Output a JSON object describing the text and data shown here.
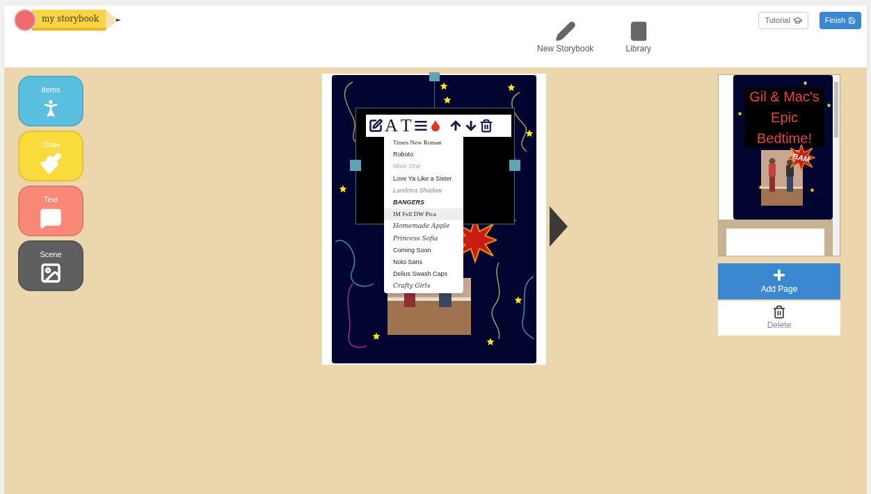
{
  "app": {
    "logo": "my storybook"
  },
  "nav": [
    {
      "kind": "pencil",
      "label": "New Storybook"
    },
    {
      "kind": "book",
      "label": "Library"
    }
  ],
  "actions": [
    {
      "kind": "tutorial",
      "label": "Tutorial"
    },
    {
      "kind": "finish",
      "label": "Finish"
    }
  ],
  "tools": [
    {
      "kind": "items",
      "label": "Items",
      "color": "#5bbfe0"
    },
    {
      "kind": "draw",
      "label": "Draw",
      "color": "#f9dc3c"
    },
    {
      "kind": "text",
      "label": "Text",
      "color": "#fa8877"
    },
    {
      "kind": "scene",
      "label": "Scene",
      "color": "#5f5f5f"
    }
  ],
  "editor": {
    "toolbar": [
      {
        "kind": "edit"
      },
      {
        "kind": "font",
        "glyph": "A"
      },
      {
        "kind": "size",
        "glyph": "T"
      },
      {
        "kind": "align"
      },
      {
        "kind": "color"
      },
      {
        "kind": "up"
      },
      {
        "kind": "down"
      },
      {
        "kind": "delete"
      }
    ],
    "font_menu": [
      {
        "label": "Times New Roman",
        "kind": "serif",
        "selected": false
      },
      {
        "label": "Roboto",
        "kind": "sans",
        "selected": false
      },
      {
        "label": "Nixie One",
        "kind": "faint",
        "selected": false
      },
      {
        "label": "Love Ya Like a Sister",
        "kind": "sans",
        "selected": false
      },
      {
        "label": "Landrina Shadow",
        "kind": "ghost",
        "selected": false
      },
      {
        "label": "BANGERS",
        "kind": "heavy",
        "selected": false
      },
      {
        "label": "IM Fell DW Pica",
        "kind": "serif",
        "selected": true
      },
      {
        "label": "Homemade Apple",
        "kind": "script",
        "selected": false
      },
      {
        "label": "Princess Sofia",
        "kind": "script",
        "selected": false
      },
      {
        "label": "Coming Soon",
        "kind": "sans",
        "selected": false
      },
      {
        "label": "Noto Sans",
        "kind": "sans",
        "selected": false
      },
      {
        "label": "Delius Swash Caps",
        "kind": "sans",
        "selected": false
      },
      {
        "label": "Crafty Girls",
        "kind": "script",
        "selected": false
      }
    ]
  },
  "pages": {
    "thumbnail_title": "Gil & Mac's Epic Bedtime!",
    "thumbnail_sticker": "BAM"
  },
  "page_actions": [
    {
      "kind": "add",
      "label": "Add Page"
    },
    {
      "kind": "delete",
      "label": "Delete"
    }
  ]
}
